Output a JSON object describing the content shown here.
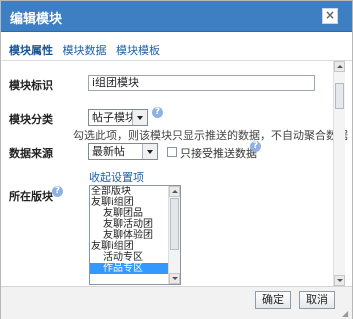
{
  "dialog": {
    "title": "编辑模块",
    "close_glyph": "×"
  },
  "tabs": [
    {
      "label": "模块属性",
      "active": true
    },
    {
      "label": "模块数据",
      "active": false
    },
    {
      "label": "模块模板",
      "active": false
    }
  ],
  "form": {
    "module_id": {
      "label": "模块标识",
      "value": "i组团模块"
    },
    "module_category": {
      "label": "模块分类",
      "selected": "帖子模块",
      "hint": "勾选此项，则该模块只显示推送的数据，不自动聚合数据"
    },
    "data_source": {
      "label": "数据来源",
      "selected": "最新帖",
      "checkbox_label": "只接受推送数据",
      "checked": false
    },
    "collapse_link": "收起设置项",
    "board": {
      "label": "所在版块",
      "options": [
        {
          "label": "全部版块",
          "indent": 0,
          "selected": false
        },
        {
          "label": "友聊i组团",
          "indent": 0,
          "selected": false
        },
        {
          "label": "友聊团品",
          "indent": 1,
          "selected": false
        },
        {
          "label": "友聊活动团",
          "indent": 1,
          "selected": false
        },
        {
          "label": "友聊体验团",
          "indent": 1,
          "selected": false
        },
        {
          "label": "友聊i组团",
          "indent": 0,
          "selected": false
        },
        {
          "label": "活动专区",
          "indent": 1,
          "selected": false
        },
        {
          "label": "作品专区",
          "indent": 1,
          "selected": true
        }
      ]
    }
  },
  "icons": {
    "help": "?"
  },
  "footer": {
    "confirm_label": "确定",
    "cancel_label": "取消"
  },
  "colors": {
    "titlebar": "#3e7fc3",
    "selection": "#3399ff",
    "link": "#1f5fa9"
  }
}
